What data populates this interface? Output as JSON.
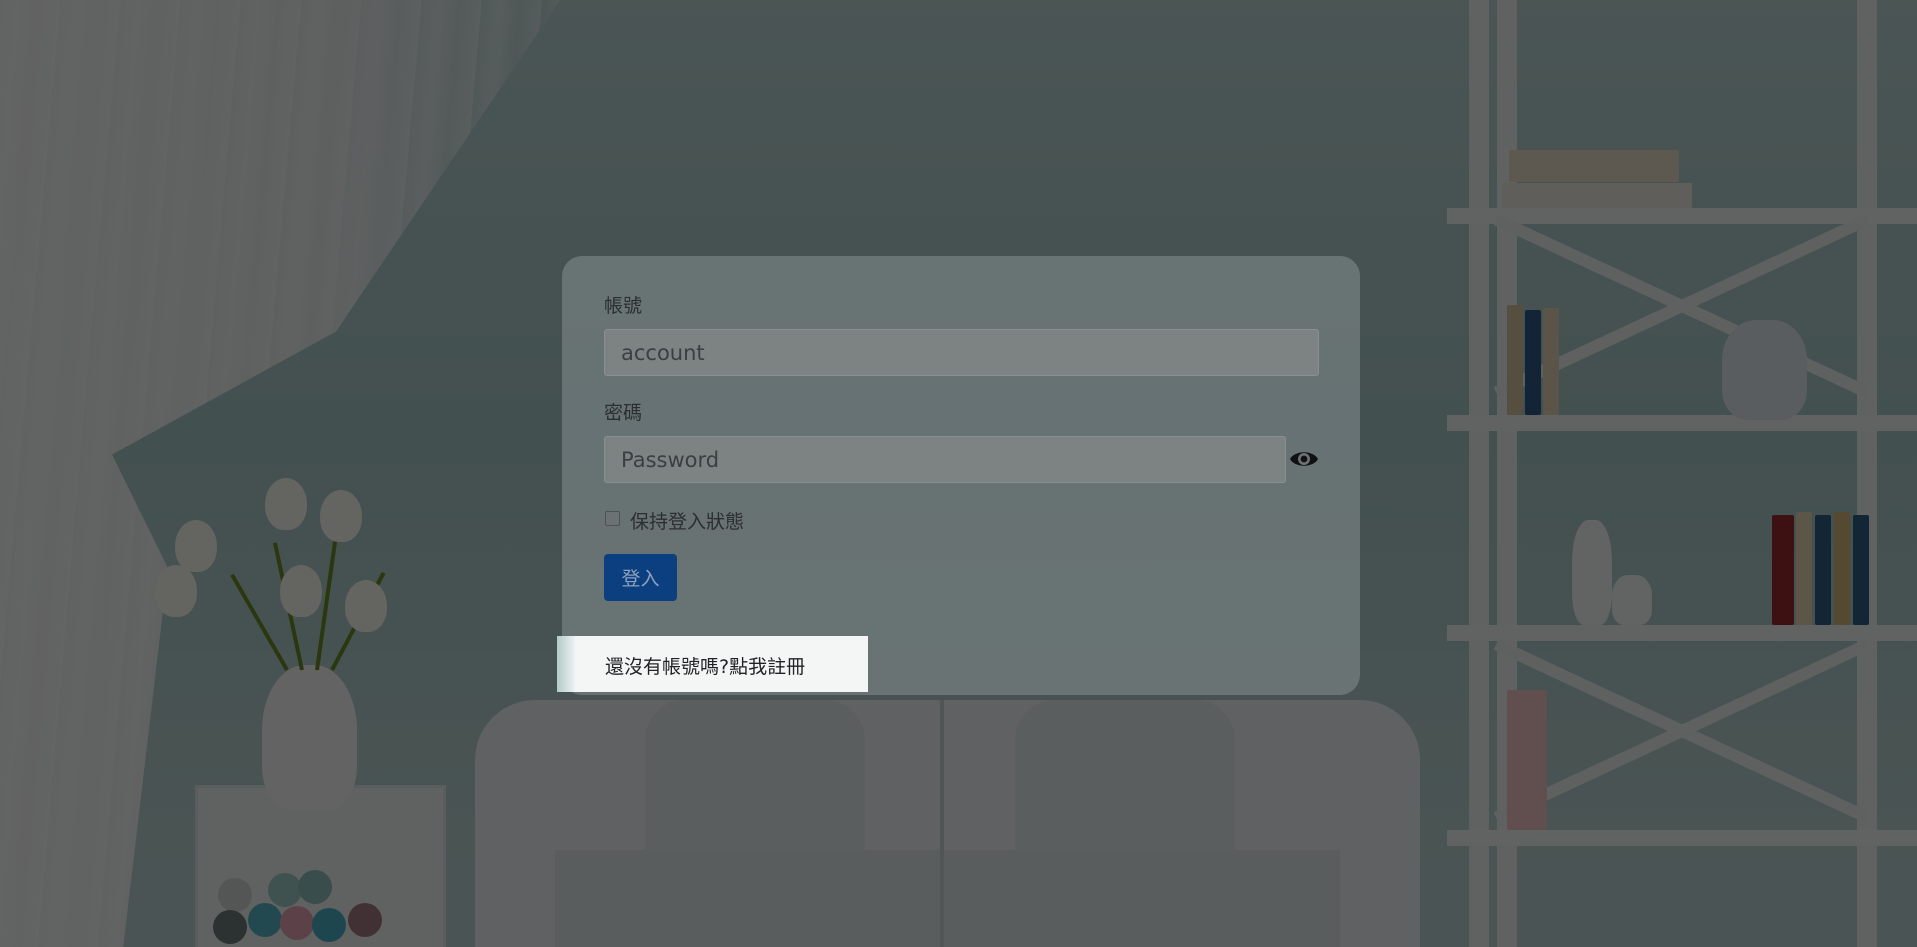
{
  "form": {
    "account_label": "帳號",
    "account_placeholder": "account",
    "password_label": "密碼",
    "password_placeholder": "Password",
    "keep_login_label": "保持登入狀態",
    "login_button": "登入",
    "register_link": "還沒有帳號嗎?點我註冊"
  },
  "icons": {
    "password_toggle": "eye-icon"
  },
  "colors": {
    "login_button": "#0b3f80"
  }
}
